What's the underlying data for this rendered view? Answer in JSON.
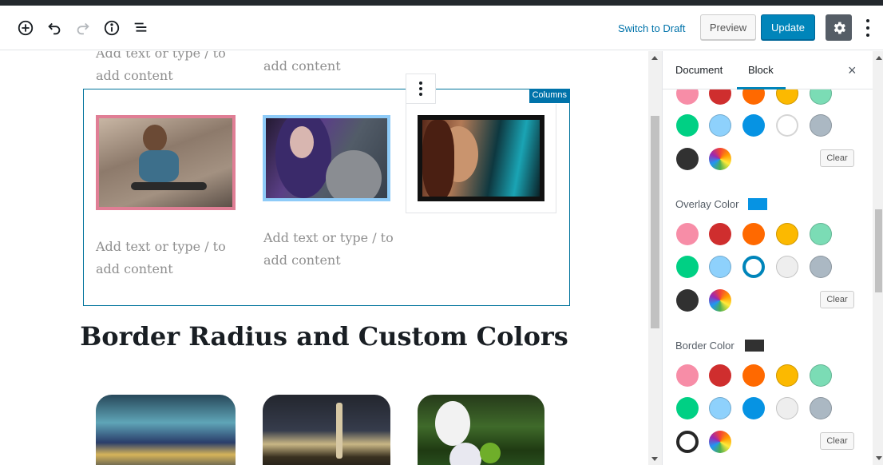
{
  "toolbar": {
    "switch_to_draft": "Switch to Draft",
    "preview": "Preview",
    "update": "Update"
  },
  "icons": [
    "add-block-icon",
    "undo-icon",
    "redo-icon",
    "info-icon",
    "outline-icon",
    "gear-icon",
    "more-menu-icon"
  ],
  "editor": {
    "top_placeholders": [
      "Add text or type / to\nadd content",
      "add content"
    ],
    "columns_label": "Columns",
    "column_placeholders": [
      "Add text or type / to\nadd content",
      "Add text or type / to\nadd content"
    ],
    "heading": "Border Radius and Custom Colors"
  },
  "sidebar": {
    "tabs": [
      "Document",
      "Block"
    ],
    "active_tab": "Block",
    "close": "×",
    "clear_label": "Clear",
    "palette": [
      "#f78da7",
      "#cf2e2e",
      "#ff6900",
      "#fcb900",
      "#7bdcb5",
      "#00d084",
      "#8ed1fc",
      "#0693e3",
      "#eeeeee",
      "#abb8c3",
      "#313131"
    ],
    "sections": [
      {
        "label": "",
        "indicator": "",
        "selected": "#eeeeee"
      },
      {
        "label": "Overlay Color",
        "indicator": "#0693e3",
        "selected": "#0693e3"
      },
      {
        "label": "Border Color",
        "indicator": "#313131",
        "selected": "#313131"
      }
    ]
  }
}
